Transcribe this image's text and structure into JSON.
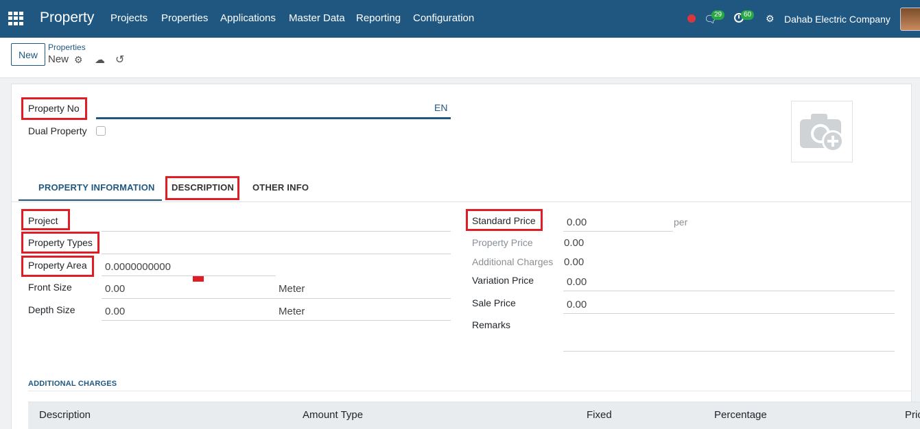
{
  "navbar": {
    "brand": "Property",
    "menu": [
      "Projects",
      "Properties",
      "Applications",
      "Master Data",
      "Reporting",
      "Configuration"
    ],
    "messages_count": "29",
    "activities_count": "60",
    "company": "Dahab Electric Company"
  },
  "control": {
    "new_label": "New",
    "breadcrumb_parent": "Properties",
    "breadcrumb_current": "New"
  },
  "form": {
    "property_no_label": "Property No",
    "property_no_lang": "EN",
    "dual_property_label": "Dual Property",
    "tabs": [
      "PROPERTY INFORMATION",
      "DESCRIPTION",
      "OTHER INFO"
    ],
    "left": {
      "project_label": "Project",
      "property_types_label": "Property Types",
      "property_area_label": "Property Area",
      "property_area_value": "0.0000000000",
      "front_size_label": "Front Size",
      "front_size_value": "0.00",
      "front_size_unit": "Meter",
      "depth_size_label": "Depth Size",
      "depth_size_value": "0.00",
      "depth_size_unit": "Meter"
    },
    "right": {
      "standard_price_label": "Standard Price",
      "standard_price_value": "0.00",
      "standard_price_per": "per",
      "property_price_label": "Property Price",
      "property_price_value": "0.00",
      "additional_charges_label": "Additional Charges",
      "additional_charges_value": "0.00",
      "variation_price_label": "Variation Price",
      "variation_price_value": "0.00",
      "sale_price_label": "Sale Price",
      "sale_price_value": "0.00",
      "remarks_label": "Remarks"
    },
    "additional_charges_section": "ADDITIONAL CHARGES",
    "table_headers": [
      "Description",
      "Amount Type",
      "Fixed",
      "Percentage",
      "Pric"
    ]
  }
}
